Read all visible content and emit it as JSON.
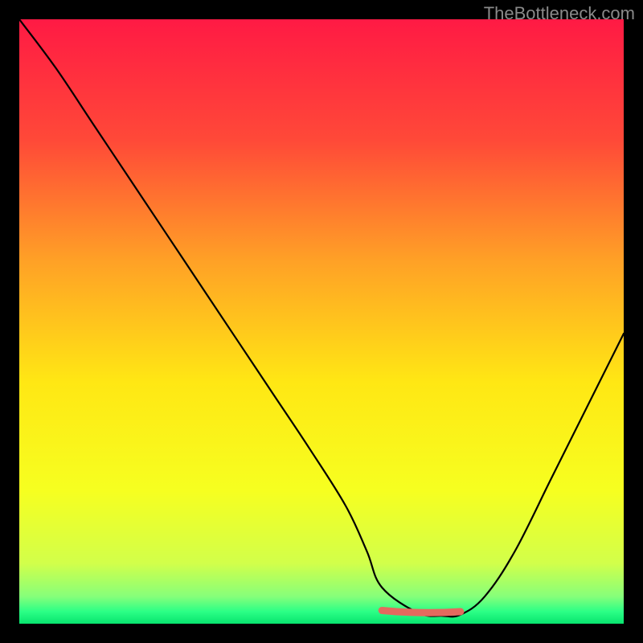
{
  "watermark": "TheBottleneck.com",
  "chart_data": {
    "type": "line",
    "title": "",
    "xlabel": "",
    "ylabel": "",
    "xlim": [
      0,
      100
    ],
    "ylim": [
      0,
      100
    ],
    "grid": false,
    "legend": false,
    "background_gradient": {
      "stops": [
        {
          "offset": 0.0,
          "color": "#ff1a44"
        },
        {
          "offset": 0.2,
          "color": "#ff4938"
        },
        {
          "offset": 0.4,
          "color": "#ffa126"
        },
        {
          "offset": 0.6,
          "color": "#ffe714"
        },
        {
          "offset": 0.78,
          "color": "#f6ff20"
        },
        {
          "offset": 0.9,
          "color": "#d2ff4a"
        },
        {
          "offset": 0.955,
          "color": "#86ff7a"
        },
        {
          "offset": 0.98,
          "color": "#2bff86"
        },
        {
          "offset": 1.0,
          "color": "#08e46e"
        }
      ]
    },
    "series": [
      {
        "name": "bottleneck-curve",
        "color": "#000000",
        "x": [
          0.0,
          6.0,
          12.0,
          18.0,
          24.0,
          30.0,
          36.0,
          42.0,
          48.0,
          54.0,
          57.5,
          60.0,
          66.0,
          70.0,
          73.0,
          77.0,
          82.0,
          88.0,
          94.0,
          100.0
        ],
        "y": [
          100.0,
          92.0,
          83.0,
          74.0,
          65.0,
          56.0,
          47.0,
          38.0,
          29.0,
          19.5,
          12.0,
          6.0,
          1.8,
          1.3,
          1.5,
          4.5,
          12.0,
          24.0,
          36.0,
          48.0
        ]
      }
    ],
    "annotations": [
      {
        "name": "optimal-range-marker",
        "type": "segment",
        "color": "#e46a5e",
        "x": [
          60.0,
          73.0
        ],
        "y": [
          2.2,
          2.0
        ]
      }
    ]
  }
}
